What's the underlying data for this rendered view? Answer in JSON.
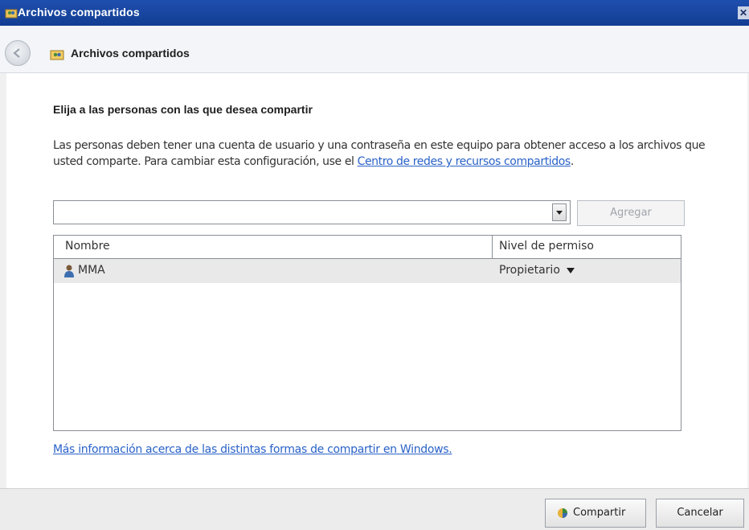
{
  "window": {
    "title": "Archivos compartidos",
    "close_glyph": "✕"
  },
  "nav": {
    "title": "Archivos compartidos"
  },
  "main": {
    "heading": "Elija a las personas con las que desea compartir",
    "description_text": "Las personas deben tener una cuenta de usuario y una contraseña en este equipo para obtener acceso a los archivos que usted comparte. Para cambiar esta configuración, use el ",
    "description_link": "Centro de redes y recursos compartidos",
    "description_end": ".",
    "input_value": "",
    "add_button": "Agregar",
    "table": {
      "columns": [
        "Nombre",
        "Nivel de permiso"
      ],
      "rows": [
        {
          "name": "MMA",
          "permission": "Propietario"
        }
      ]
    },
    "more_info_link": "Más información acerca de las distintas formas de compartir en Windows."
  },
  "footer": {
    "share_button": "Compartir",
    "cancel_button": "Cancelar"
  },
  "icons": {
    "title": "shared-folder-icon",
    "nav": "shared-folder-icon",
    "back": "back-arrow-icon",
    "user": "user-icon",
    "share": "share-shield-icon",
    "dropdown": "chevron-down-icon"
  },
  "colors": {
    "titlebar": "#1f4fae",
    "link": "#2a62c8",
    "selected_row": "#e9e9e9"
  }
}
